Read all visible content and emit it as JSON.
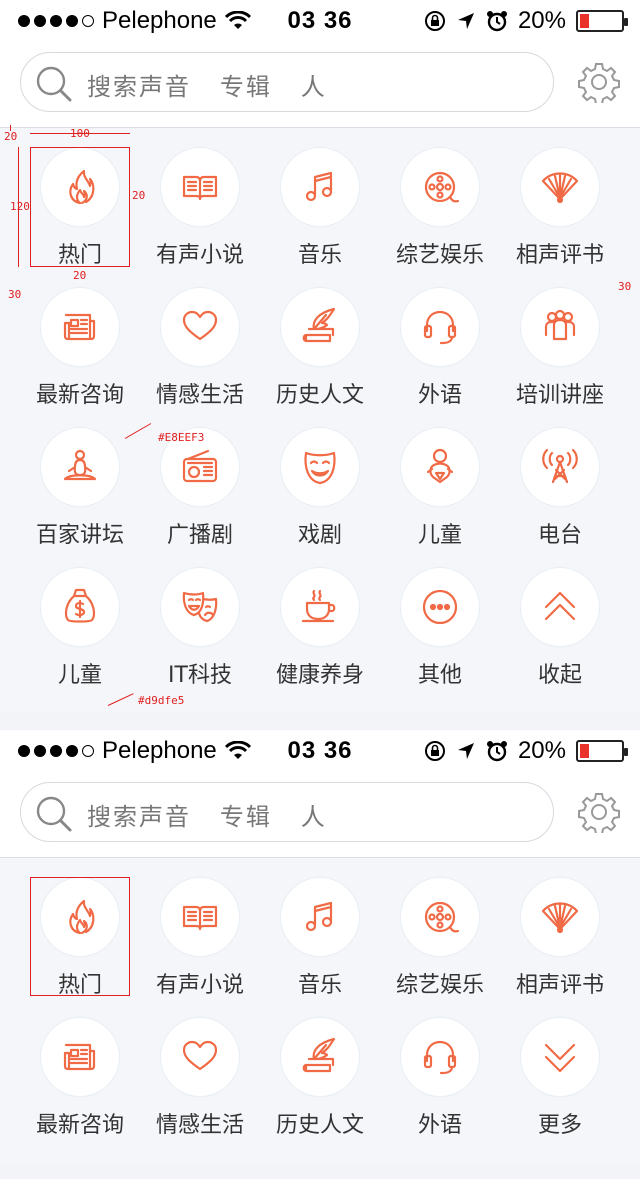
{
  "status_bar": {
    "carrier": "Pelephone",
    "time": "03 36",
    "battery": "20%",
    "battery_level": 0.2
  },
  "search": {
    "placeholder": "搜索声音   专辑   人"
  },
  "colors": {
    "accent": "#f06a45",
    "circle_border": "#E8EEF3",
    "divider": "#d9dfe5"
  },
  "screen1": {
    "categories": [
      {
        "label": "热门",
        "icon": "fire-icon"
      },
      {
        "label": "有声小说",
        "icon": "book-icon"
      },
      {
        "label": "音乐",
        "icon": "music-note-icon"
      },
      {
        "label": "综艺娱乐",
        "icon": "film-reel-icon"
      },
      {
        "label": "相声评书",
        "icon": "fan-icon"
      },
      {
        "label": "最新咨询",
        "icon": "newspaper-icon"
      },
      {
        "label": "情感生活",
        "icon": "heart-icon"
      },
      {
        "label": "历史人文",
        "icon": "quill-books-icon"
      },
      {
        "label": "外语",
        "icon": "headset-icon"
      },
      {
        "label": "培训讲座",
        "icon": "group-icon"
      },
      {
        "label": "百家讲坛",
        "icon": "meditation-icon"
      },
      {
        "label": "广播剧",
        "icon": "radio-icon"
      },
      {
        "label": "戏剧",
        "icon": "opera-mask-icon"
      },
      {
        "label": "儿童",
        "icon": "baby-icon"
      },
      {
        "label": "电台",
        "icon": "broadcast-tower-icon"
      },
      {
        "label": "儿童",
        "icon": "money-bag-icon"
      },
      {
        "label": "IT科技",
        "icon": "masks-icon"
      },
      {
        "label": "健康养身",
        "icon": "tea-cup-icon"
      },
      {
        "label": "其他",
        "icon": "more-dots-icon"
      },
      {
        "label": "收起",
        "icon": "chevron-up-icon"
      }
    ]
  },
  "screen2": {
    "categories": [
      {
        "label": "热门",
        "icon": "fire-icon"
      },
      {
        "label": "有声小说",
        "icon": "book-icon"
      },
      {
        "label": "音乐",
        "icon": "music-note-icon"
      },
      {
        "label": "综艺娱乐",
        "icon": "film-reel-icon"
      },
      {
        "label": "相声评书",
        "icon": "fan-icon"
      },
      {
        "label": "最新咨询",
        "icon": "newspaper-icon"
      },
      {
        "label": "情感生活",
        "icon": "heart-icon"
      },
      {
        "label": "历史人文",
        "icon": "quill-books-icon"
      },
      {
        "label": "外语",
        "icon": "headset-icon"
      },
      {
        "label": "更多",
        "icon": "chevron-down-icon"
      }
    ]
  },
  "annotations": {
    "size_100": "100",
    "size_120": "120",
    "gap_20_top": "20",
    "gap_20_right": "20",
    "gap_20_bottom": "20",
    "margin_30_left": "30",
    "margin_30_right": "30",
    "circle_color": "#E8EEF3",
    "divider_color": "#d9dfe5"
  }
}
